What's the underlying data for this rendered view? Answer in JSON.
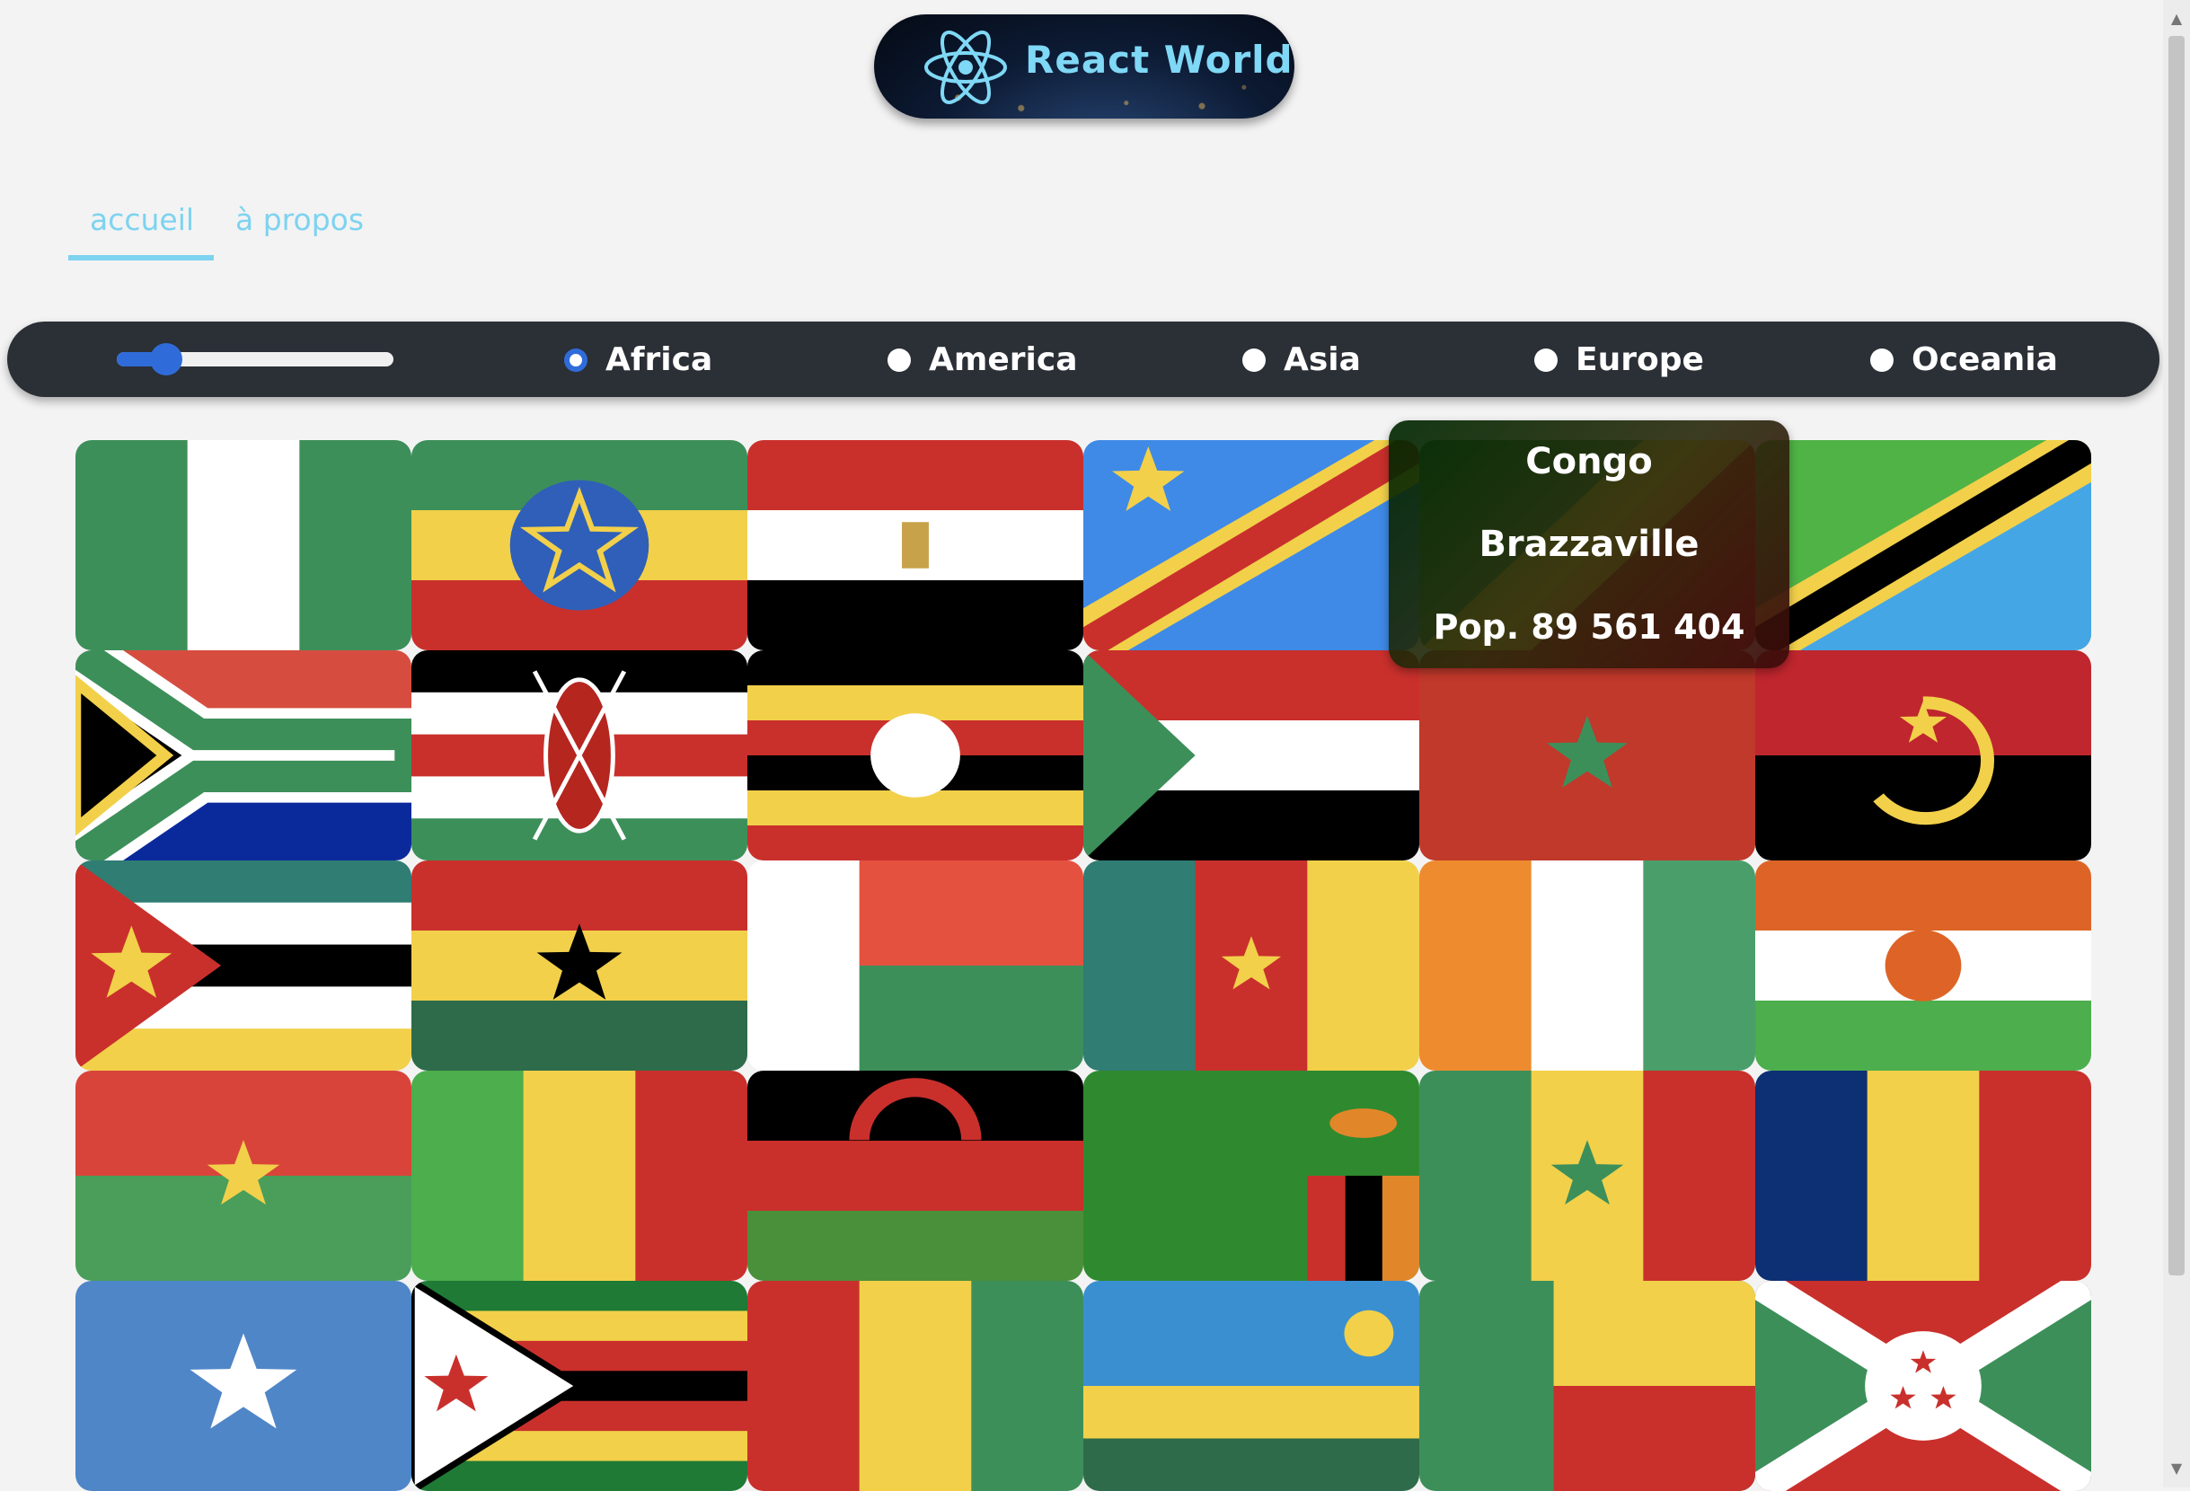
{
  "header": {
    "logo_text": "React World"
  },
  "nav": {
    "items": [
      {
        "label": "accueil",
        "active": true
      },
      {
        "label": "à propos",
        "active": false
      }
    ]
  },
  "filters": {
    "range_value": 0.18,
    "regions": [
      {
        "label": "Africa",
        "checked": true
      },
      {
        "label": "America",
        "checked": false
      },
      {
        "label": "Asia",
        "checked": false
      },
      {
        "label": "Europe",
        "checked": false
      },
      {
        "label": "Oceania",
        "checked": false
      }
    ]
  },
  "flags": [
    "nigeria",
    "ethiopia",
    "egypt",
    "dr-congo",
    "congo",
    "tanzania",
    "south-africa",
    "kenya",
    "uganda",
    "sudan",
    "morocco",
    "angola",
    "mozambique",
    "ghana",
    "madagascar",
    "cameroon",
    "ivory-coast",
    "niger",
    "burkina-faso",
    "mali",
    "malawi",
    "zambia",
    "senegal",
    "chad",
    "somalia",
    "zimbabwe",
    "guinea",
    "rwanda",
    "benin",
    "burundi"
  ],
  "tooltip": {
    "line1": "Congo",
    "line2": "Brazzaville",
    "population": "Pop. 89 561 404"
  },
  "colors": {
    "accent": "#7dd3f0",
    "bar": "#2b2f36",
    "radio": "#2f6cd9"
  }
}
